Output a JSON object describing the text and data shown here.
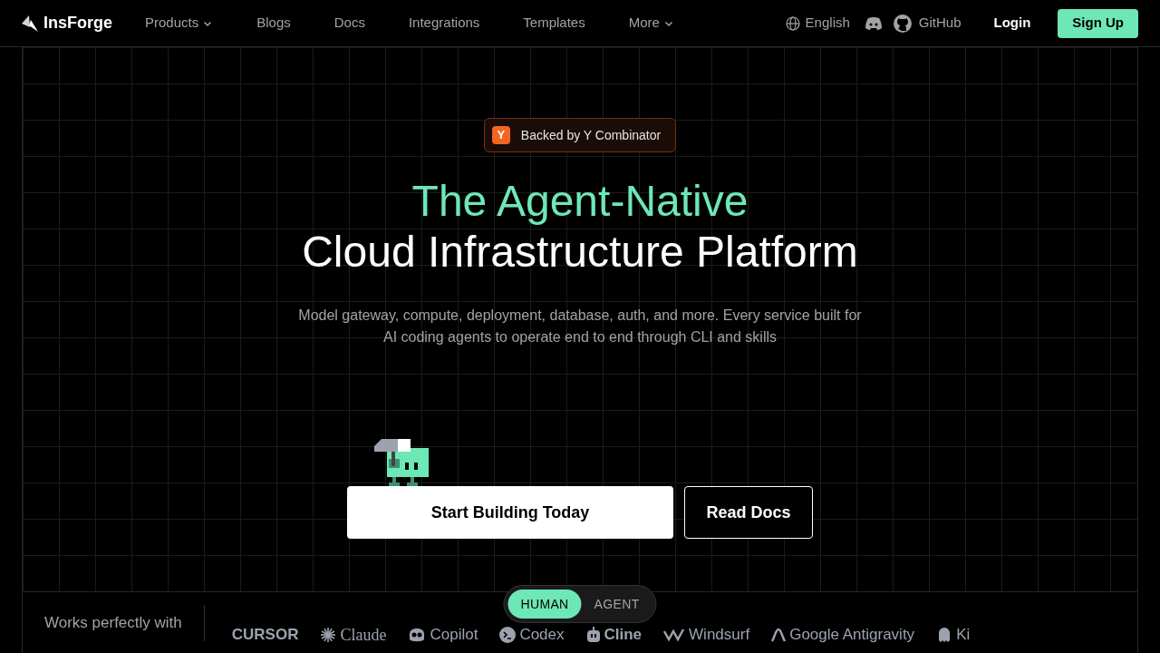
{
  "brand": "InsForge",
  "nav": [
    {
      "label": "Products",
      "dropdown": true
    },
    {
      "label": "Blogs",
      "dropdown": false
    },
    {
      "label": "Docs",
      "dropdown": false
    },
    {
      "label": "Integrations",
      "dropdown": false
    },
    {
      "label": "Templates",
      "dropdown": false
    },
    {
      "label": "More",
      "dropdown": true
    }
  ],
  "language": "English",
  "github": "GitHub",
  "login": "Login",
  "signup": "Sign Up",
  "badge": {
    "letter": "Y",
    "text": "Backed by Y Combinator"
  },
  "headline": [
    "The Agent-Native",
    "Cloud Infrastructure Platform"
  ],
  "subtitle": [
    "Model gateway, compute, deployment, database, auth, and more. Every service built for",
    "AI coding agents to operate end to end through CLI and skills"
  ],
  "buttons": [
    {
      "label": "Start Building Today",
      "kind": "primary"
    },
    {
      "label": "Read Docs",
      "kind": "outline"
    }
  ],
  "mode_toggle": [
    {
      "label": "HUMAN",
      "selected": true
    },
    {
      "label": "AGENT",
      "selected": false
    }
  ],
  "works_with": "Works perfectly with",
  "partners": [
    {
      "name": "CURSOR",
      "kind": "cursor"
    },
    {
      "name": "Claude",
      "kind": "claude"
    },
    {
      "name": "Copilot",
      "kind": "copilot"
    },
    {
      "name": "Codex",
      "kind": "codex"
    },
    {
      "name": "Cline",
      "kind": "cline"
    },
    {
      "name": "Windsurf",
      "kind": "windsurf"
    },
    {
      "name": "Google Antigravity",
      "kind": "antigravity"
    },
    {
      "name": "Ki",
      "kind": "kiro"
    }
  ]
}
